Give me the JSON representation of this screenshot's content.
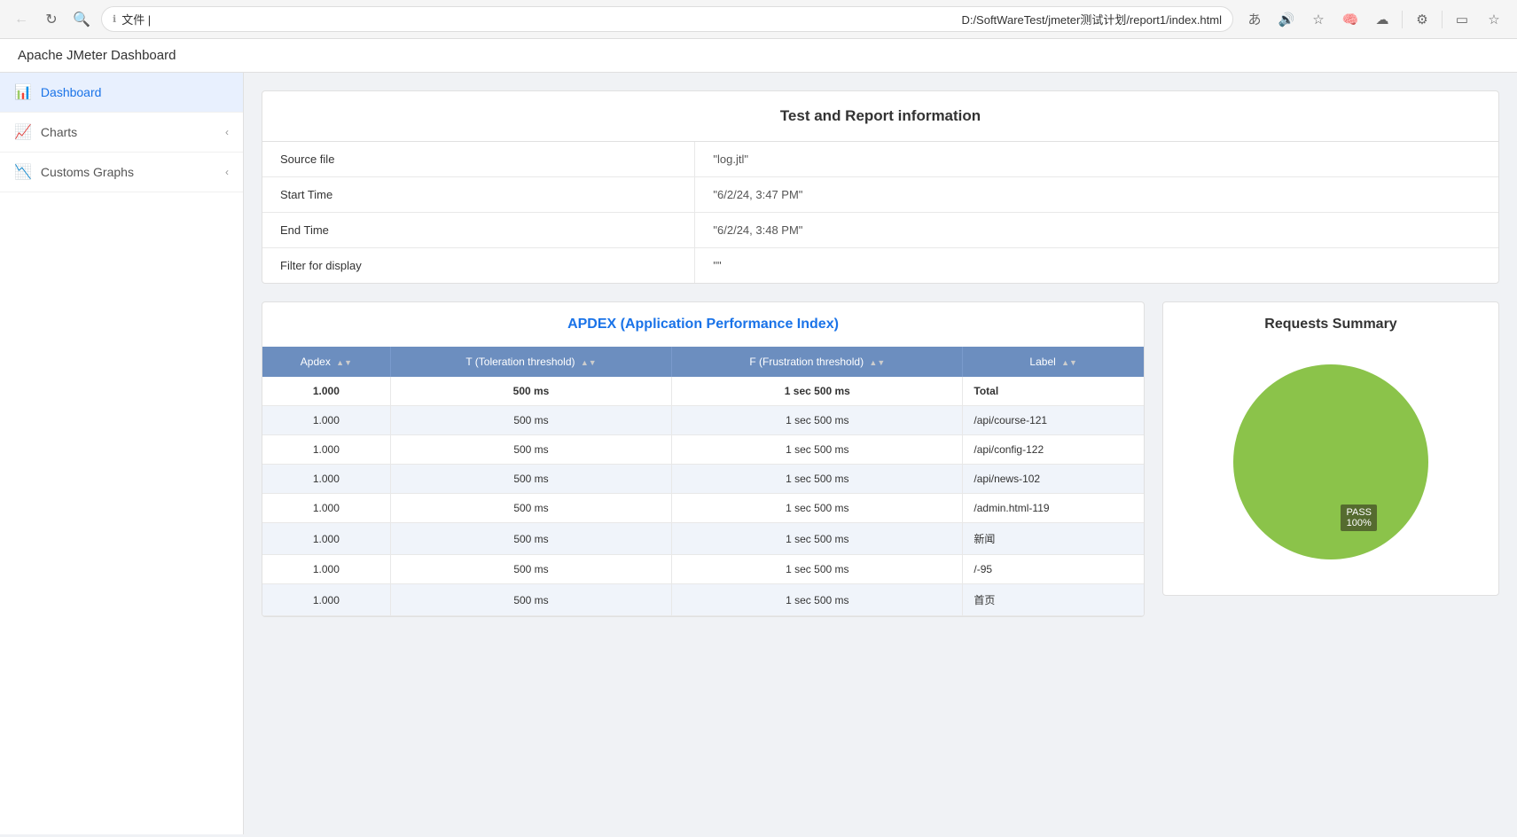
{
  "browser": {
    "url": "D:/SoftWareTest/jmeter测试计划/report1/index.html",
    "url_prefix": "文件 |",
    "info_icon": "ℹ"
  },
  "app": {
    "title": "Apache JMeter Dashboard"
  },
  "sidebar": {
    "items": [
      {
        "id": "dashboard",
        "label": "Dashboard",
        "icon": "📊",
        "active": true,
        "has_arrow": false
      },
      {
        "id": "charts",
        "label": "Charts",
        "icon": "📈",
        "active": false,
        "has_arrow": true
      },
      {
        "id": "customs-graphs",
        "label": "Customs Graphs",
        "icon": "📉",
        "active": false,
        "has_arrow": true
      }
    ]
  },
  "info_card": {
    "title": "Test and Report information",
    "rows": [
      {
        "label": "Source file",
        "value": "\"log.jtl\""
      },
      {
        "label": "Start Time",
        "value": "\"6/2/24, 3:47 PM\""
      },
      {
        "label": "End Time",
        "value": "\"6/2/24, 3:48 PM\""
      },
      {
        "label": "Filter for display",
        "value": "\"\""
      }
    ]
  },
  "apdex": {
    "title": "APDEX (Application Performance Index)",
    "columns": [
      {
        "label": "Apdex",
        "sort": true
      },
      {
        "label": "T (Toleration threshold)",
        "sort": true
      },
      {
        "label": "F (Frustration threshold)",
        "sort": true
      },
      {
        "label": "Label",
        "sort": true
      }
    ],
    "rows": [
      {
        "apdex": "1.000",
        "t": "500 ms",
        "f": "1 sec 500 ms",
        "label": "Total",
        "bold": true
      },
      {
        "apdex": "1.000",
        "t": "500 ms",
        "f": "1 sec 500 ms",
        "label": "/api/course-121",
        "bold": false
      },
      {
        "apdex": "1.000",
        "t": "500 ms",
        "f": "1 sec 500 ms",
        "label": "/api/config-122",
        "bold": false
      },
      {
        "apdex": "1.000",
        "t": "500 ms",
        "f": "1 sec 500 ms",
        "label": "/api/news-102",
        "bold": false
      },
      {
        "apdex": "1.000",
        "t": "500 ms",
        "f": "1 sec 500 ms",
        "label": "/admin.html-119",
        "bold": false
      },
      {
        "apdex": "1.000",
        "t": "500 ms",
        "f": "1 sec 500 ms",
        "label": "新闻",
        "bold": false
      },
      {
        "apdex": "1.000",
        "t": "500 ms",
        "f": "1 sec 500 ms",
        "label": "/-95",
        "bold": false
      },
      {
        "apdex": "1.000",
        "t": "500 ms",
        "f": "1 sec 500 ms",
        "label": "首页",
        "bold": false
      }
    ]
  },
  "requests_summary": {
    "title": "Requests Summary",
    "pass_label": "PASS",
    "pass_percent": "100%",
    "pie_color": "#8bc34a",
    "pass_bg": "#556b2f"
  }
}
